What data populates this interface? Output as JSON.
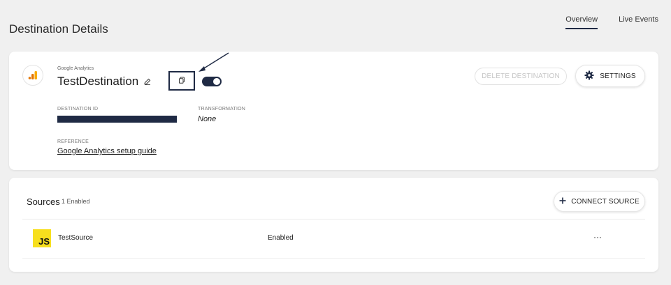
{
  "page": {
    "title": "Destination Details",
    "tabs": [
      {
        "label": "Overview",
        "active": true
      },
      {
        "label": "Live Events",
        "active": false
      }
    ]
  },
  "destination": {
    "type": "Google Analytics",
    "name": "TestDestination",
    "enabled": true,
    "delete_label": "DELETE DESTINATION",
    "settings_label": "SETTINGS",
    "id_label": "DESTINATION ID",
    "transformation_label": "TRANSFORMATION",
    "transformation_value": "None",
    "reference_label": "REFERENCE",
    "reference_link": "Google Analytics setup guide"
  },
  "sources": {
    "title": "Sources",
    "count_text": "1 Enabled",
    "connect_label": "CONNECT SOURCE",
    "rows": [
      {
        "icon_text": "JS",
        "name": "TestSource",
        "status": "Enabled",
        "more": "···"
      }
    ]
  },
  "colors": {
    "navy": "#1f2a44",
    "background": "#f0f0f0",
    "js_yellow": "#f7df1e",
    "ga_orange": "#f9ab00",
    "ga_dark_orange": "#e37400"
  },
  "icons": [
    "google-analytics-logo-icon",
    "pencil-icon",
    "copy-icon",
    "gear-icon",
    "plus-icon",
    "ellipsis-icon",
    "javascript-icon"
  ]
}
